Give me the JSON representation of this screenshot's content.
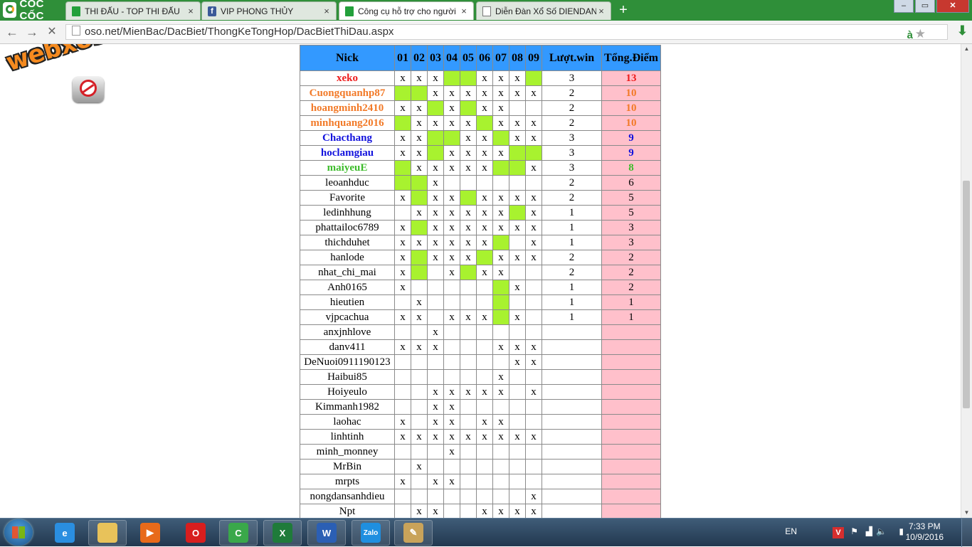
{
  "browser": {
    "brand": "CỐC CỐC",
    "tabs": [
      {
        "label": "THI ĐẤU - TOP THI ĐẤU",
        "icon": "green-page-icon",
        "active": false
      },
      {
        "label": "VIP PHONG THỦY",
        "icon": "facebook-icon",
        "active": false
      },
      {
        "label": "Công cụ hỗ trợ cho người",
        "icon": "green-page-icon",
        "active": true
      },
      {
        "label": "Diễn Đàn Xổ Số DIENDAN",
        "icon": "document-icon",
        "active": false
      }
    ],
    "tab_close": "×",
    "new_tab": "+",
    "window_buttons": {
      "minimize": "–",
      "maximize": "▭",
      "close": "✕"
    },
    "url": "oso.net/MienBac/DacBiet/ThongKeTongHop/DacBietThiDau.aspx",
    "translate_badge": "à"
  },
  "watermark": "webxoso.net",
  "table": {
    "headers": {
      "nick": "Nick",
      "days": [
        "01",
        "02",
        "03",
        "04",
        "05",
        "06",
        "07",
        "08",
        "09"
      ],
      "wins": "Lượt.win",
      "points": "Tổng.Điểm"
    },
    "rows": [
      {
        "nick": "xeko",
        "style": "red",
        "cells": [
          "x",
          "x",
          "x",
          "G",
          "G",
          "x",
          "x",
          "x",
          "G"
        ],
        "wins": "3",
        "points": "13"
      },
      {
        "nick": "Cuongquanhp87",
        "style": "orange",
        "cells": [
          "G",
          "G",
          "x",
          "x",
          "x",
          "x",
          "x",
          "x",
          "x"
        ],
        "wins": "2",
        "points": "10"
      },
      {
        "nick": "hoangminh2410",
        "style": "orange",
        "cells": [
          "x",
          "x",
          "G",
          "x",
          "G",
          "x",
          "x",
          "",
          ""
        ],
        "wins": "2",
        "points": "10"
      },
      {
        "nick": "minhquang2016",
        "style": "orange",
        "cells": [
          "G",
          "x",
          "x",
          "x",
          "x",
          "G",
          "x",
          "x",
          "x"
        ],
        "wins": "2",
        "points": "10"
      },
      {
        "nick": "Chacthang",
        "style": "blue",
        "cells": [
          "x",
          "x",
          "G",
          "G",
          "x",
          "x",
          "G",
          "x",
          "x"
        ],
        "wins": "3",
        "points": "9"
      },
      {
        "nick": "hoclamgiau",
        "style": "blue",
        "cells": [
          "x",
          "x",
          "G",
          "x",
          "x",
          "x",
          "x",
          "G",
          "G"
        ],
        "wins": "3",
        "points": "9"
      },
      {
        "nick": "maiyeuE",
        "style": "green",
        "cells": [
          "G",
          "x",
          "x",
          "x",
          "x",
          "x",
          "G",
          "G",
          "x"
        ],
        "wins": "3",
        "points": "8"
      },
      {
        "nick": "leoanhduc",
        "style": "",
        "cells": [
          "G",
          "G",
          "x",
          "",
          "",
          "",
          "",
          "",
          ""
        ],
        "wins": "2",
        "points": "6"
      },
      {
        "nick": "Favorite",
        "style": "",
        "cells": [
          "x",
          "G",
          "x",
          "x",
          "G",
          "x",
          "x",
          "x",
          "x"
        ],
        "wins": "2",
        "points": "5"
      },
      {
        "nick": "ledinhhung",
        "style": "",
        "cells": [
          "",
          "x",
          "x",
          "x",
          "x",
          "x",
          "x",
          "G",
          "x"
        ],
        "wins": "1",
        "points": "5"
      },
      {
        "nick": "phattailoc6789",
        "style": "",
        "cells": [
          "x",
          "G",
          "x",
          "x",
          "x",
          "x",
          "x",
          "x",
          "x"
        ],
        "wins": "1",
        "points": "3"
      },
      {
        "nick": "thichduhet",
        "style": "",
        "cells": [
          "x",
          "x",
          "x",
          "x",
          "x",
          "x",
          "G",
          "",
          "x"
        ],
        "wins": "1",
        "points": "3"
      },
      {
        "nick": "hanlode",
        "style": "",
        "cells": [
          "x",
          "G",
          "x",
          "x",
          "x",
          "G",
          "x",
          "x",
          "x"
        ],
        "wins": "2",
        "points": "2"
      },
      {
        "nick": "nhat_chi_mai",
        "style": "",
        "cells": [
          "x",
          "G",
          "",
          "x",
          "G",
          "x",
          "x",
          "",
          ""
        ],
        "wins": "2",
        "points": "2"
      },
      {
        "nick": "Anh0165",
        "style": "",
        "cells": [
          "x",
          "",
          "",
          "",
          "",
          "",
          "G",
          "x",
          ""
        ],
        "wins": "1",
        "points": "2"
      },
      {
        "nick": "hieutien",
        "style": "",
        "cells": [
          "",
          "x",
          "",
          "",
          "",
          "",
          "G",
          "",
          ""
        ],
        "wins": "1",
        "points": "1"
      },
      {
        "nick": "vjpcachua",
        "style": "",
        "cells": [
          "x",
          "x",
          "",
          "x",
          "x",
          "x",
          "G",
          "x",
          ""
        ],
        "wins": "1",
        "points": "1"
      },
      {
        "nick": "anxjnhlove",
        "style": "",
        "cells": [
          "",
          "",
          "x",
          "",
          "",
          "",
          "",
          "",
          ""
        ],
        "wins": "",
        "points": ""
      },
      {
        "nick": "danv411",
        "style": "",
        "cells": [
          "x",
          "x",
          "x",
          "",
          "",
          "",
          "x",
          "x",
          "x"
        ],
        "wins": "",
        "points": ""
      },
      {
        "nick": "DeNuoi0911190123",
        "style": "",
        "cells": [
          "",
          "",
          "",
          "",
          "",
          "",
          "",
          "x",
          "x"
        ],
        "wins": "",
        "points": ""
      },
      {
        "nick": "Haibui85",
        "style": "",
        "cells": [
          "",
          "",
          "",
          "",
          "",
          "",
          "x",
          "",
          ""
        ],
        "wins": "",
        "points": ""
      },
      {
        "nick": "Hoiyeulo",
        "style": "",
        "cells": [
          "",
          "",
          "x",
          "x",
          "x",
          "x",
          "x",
          "",
          "x"
        ],
        "wins": "",
        "points": ""
      },
      {
        "nick": "Kimmanh1982",
        "style": "",
        "cells": [
          "",
          "",
          "x",
          "x",
          "",
          "",
          "",
          "",
          ""
        ],
        "wins": "",
        "points": ""
      },
      {
        "nick": "laohac",
        "style": "",
        "cells": [
          "x",
          "",
          "x",
          "x",
          "",
          "x",
          "x",
          "",
          ""
        ],
        "wins": "",
        "points": ""
      },
      {
        "nick": "linhtinh",
        "style": "",
        "cells": [
          "x",
          "x",
          "x",
          "x",
          "x",
          "x",
          "x",
          "x",
          "x"
        ],
        "wins": "",
        "points": ""
      },
      {
        "nick": "minh_monney",
        "style": "",
        "cells": [
          "",
          "",
          "",
          "x",
          "",
          "",
          "",
          "",
          ""
        ],
        "wins": "",
        "points": ""
      },
      {
        "nick": "MrBin",
        "style": "",
        "cells": [
          "",
          "x",
          "",
          "",
          "",
          "",
          "",
          "",
          ""
        ],
        "wins": "",
        "points": ""
      },
      {
        "nick": "mrpts",
        "style": "",
        "cells": [
          "x",
          "",
          "x",
          "x",
          "",
          "",
          "",
          "",
          ""
        ],
        "wins": "",
        "points": ""
      },
      {
        "nick": "nongdansanhdieu",
        "style": "",
        "cells": [
          "",
          "",
          "",
          "",
          "",
          "",
          "",
          "",
          "x"
        ],
        "wins": "",
        "points": ""
      },
      {
        "nick": "Npt",
        "style": "",
        "cells": [
          "",
          "x",
          "x",
          "",
          "",
          "x",
          "x",
          "x",
          "x"
        ],
        "wins": "",
        "points": ""
      }
    ]
  },
  "taskbar": {
    "apps": [
      {
        "name": "internet-explorer-icon",
        "glyph": "e",
        "color": "#2a8ee0",
        "open": false
      },
      {
        "name": "file-explorer-icon",
        "glyph": "",
        "color": "#e8c25a",
        "open": true
      },
      {
        "name": "media-player-icon",
        "glyph": "▶",
        "color": "#e86a1a",
        "open": false
      },
      {
        "name": "opera-icon",
        "glyph": "O",
        "color": "#d81e1e",
        "open": false
      },
      {
        "name": "coccoc-icon",
        "glyph": "C",
        "color": "#3aa84a",
        "open": true
      },
      {
        "name": "excel-icon",
        "glyph": "X",
        "color": "#1f7b3a",
        "open": true
      },
      {
        "name": "word-icon",
        "glyph": "W",
        "color": "#2b5fb4",
        "open": true
      },
      {
        "name": "zalo-icon",
        "glyph": "Zalo",
        "color": "#1f8fe0",
        "open": true
      },
      {
        "name": "paint-icon",
        "glyph": "✎",
        "color": "#c9a35a",
        "open": true
      }
    ],
    "lang": "EN",
    "time": "7:33 PM",
    "date": "10/9/2016"
  }
}
